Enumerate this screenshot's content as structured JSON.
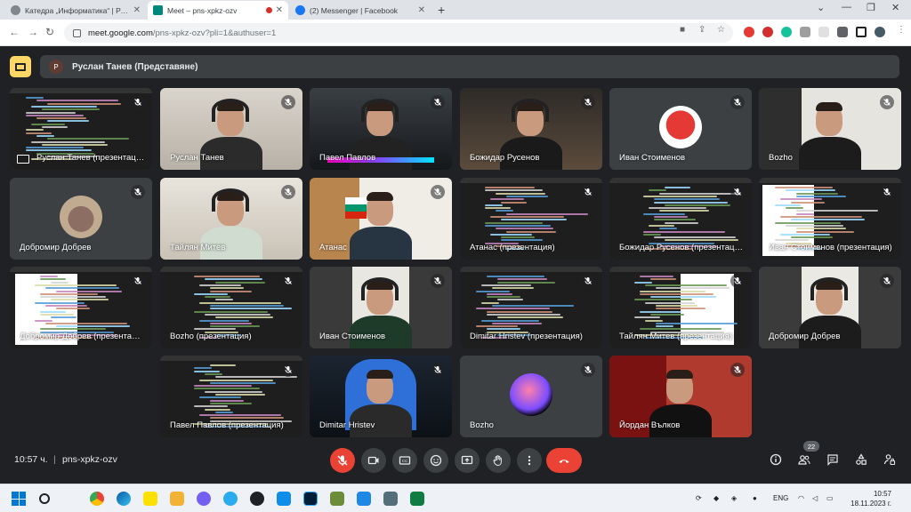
{
  "browser": {
    "tabs": [
      {
        "title": "Катедра „Информатика“ | Регал",
        "active": false,
        "favicon_color": "#5f6368"
      },
      {
        "title": "Meet – pns-xpkz-ozv",
        "active": true,
        "favicon_color": "#00897b"
      },
      {
        "title": "(2) Messenger | Facebook",
        "active": false,
        "favicon_color": "#1877f2"
      }
    ],
    "url_host": "meet.google.com",
    "url_path": "/pns-xpkz-ozv?pli=1&authuser=1"
  },
  "meet": {
    "presenter_label": "Руслан Танев (Представяне)",
    "presenter_initial": "Р",
    "time": "10:57 ч.",
    "separator": "|",
    "meeting_code": "pns-xpkz-ozv",
    "participant_count": "22",
    "accent_red": "#ea4335",
    "tiles": [
      {
        "name": "Руслан Танев (презентация)",
        "kind": "screen",
        "variant": 0
      },
      {
        "name": "Руслан Танев",
        "kind": "cam",
        "variant": 0
      },
      {
        "name": "Павел Павлов",
        "kind": "cam",
        "variant": 1
      },
      {
        "name": "Божидар Русенов",
        "kind": "cam",
        "variant": 2
      },
      {
        "name": "Иван Стоименов",
        "kind": "avatar",
        "variant": 0
      },
      {
        "name": "Bozho",
        "kind": "cam",
        "variant": 3
      },
      {
        "name": "Добромир Добрев",
        "kind": "avatar",
        "variant": 1
      },
      {
        "name": "Тайлян Митев",
        "kind": "cam",
        "variant": 4
      },
      {
        "name": "Атанас",
        "kind": "cam",
        "variant": 5
      },
      {
        "name": "Атанас (презентация)",
        "kind": "screen",
        "variant": 1
      },
      {
        "name": "Божидар Русенов (презентация)",
        "kind": "screen",
        "variant": 2
      },
      {
        "name": "Иван Стоименов (презентация)",
        "kind": "screen",
        "variant": 3
      },
      {
        "name": "Добромир Добрев (презентация)",
        "kind": "screen",
        "variant": 4
      },
      {
        "name": "Bozho (презентация)",
        "kind": "screen",
        "variant": 5
      },
      {
        "name": "Иван Стоименов",
        "kind": "cam",
        "variant": 6
      },
      {
        "name": "Dimitar Hristev (презентация)",
        "kind": "screen",
        "variant": 6
      },
      {
        "name": "Тайлян Митев (презентация)",
        "kind": "screen",
        "variant": 7
      },
      {
        "name": "Добромир Добрев",
        "kind": "cam",
        "variant": 7
      },
      {
        "name": "Павел Павлов (презентация)",
        "kind": "screen",
        "variant": 8
      },
      {
        "name": "Dimitar Hristev",
        "kind": "cam",
        "variant": 8
      },
      {
        "name": "Bozho",
        "kind": "avatar",
        "variant": 2
      },
      {
        "name": "Йордан Вълков",
        "kind": "cam",
        "variant": 9
      }
    ]
  },
  "taskbar": {
    "language": "ENG",
    "clock_time": "10:57",
    "clock_date": "18.11.2023 г."
  }
}
